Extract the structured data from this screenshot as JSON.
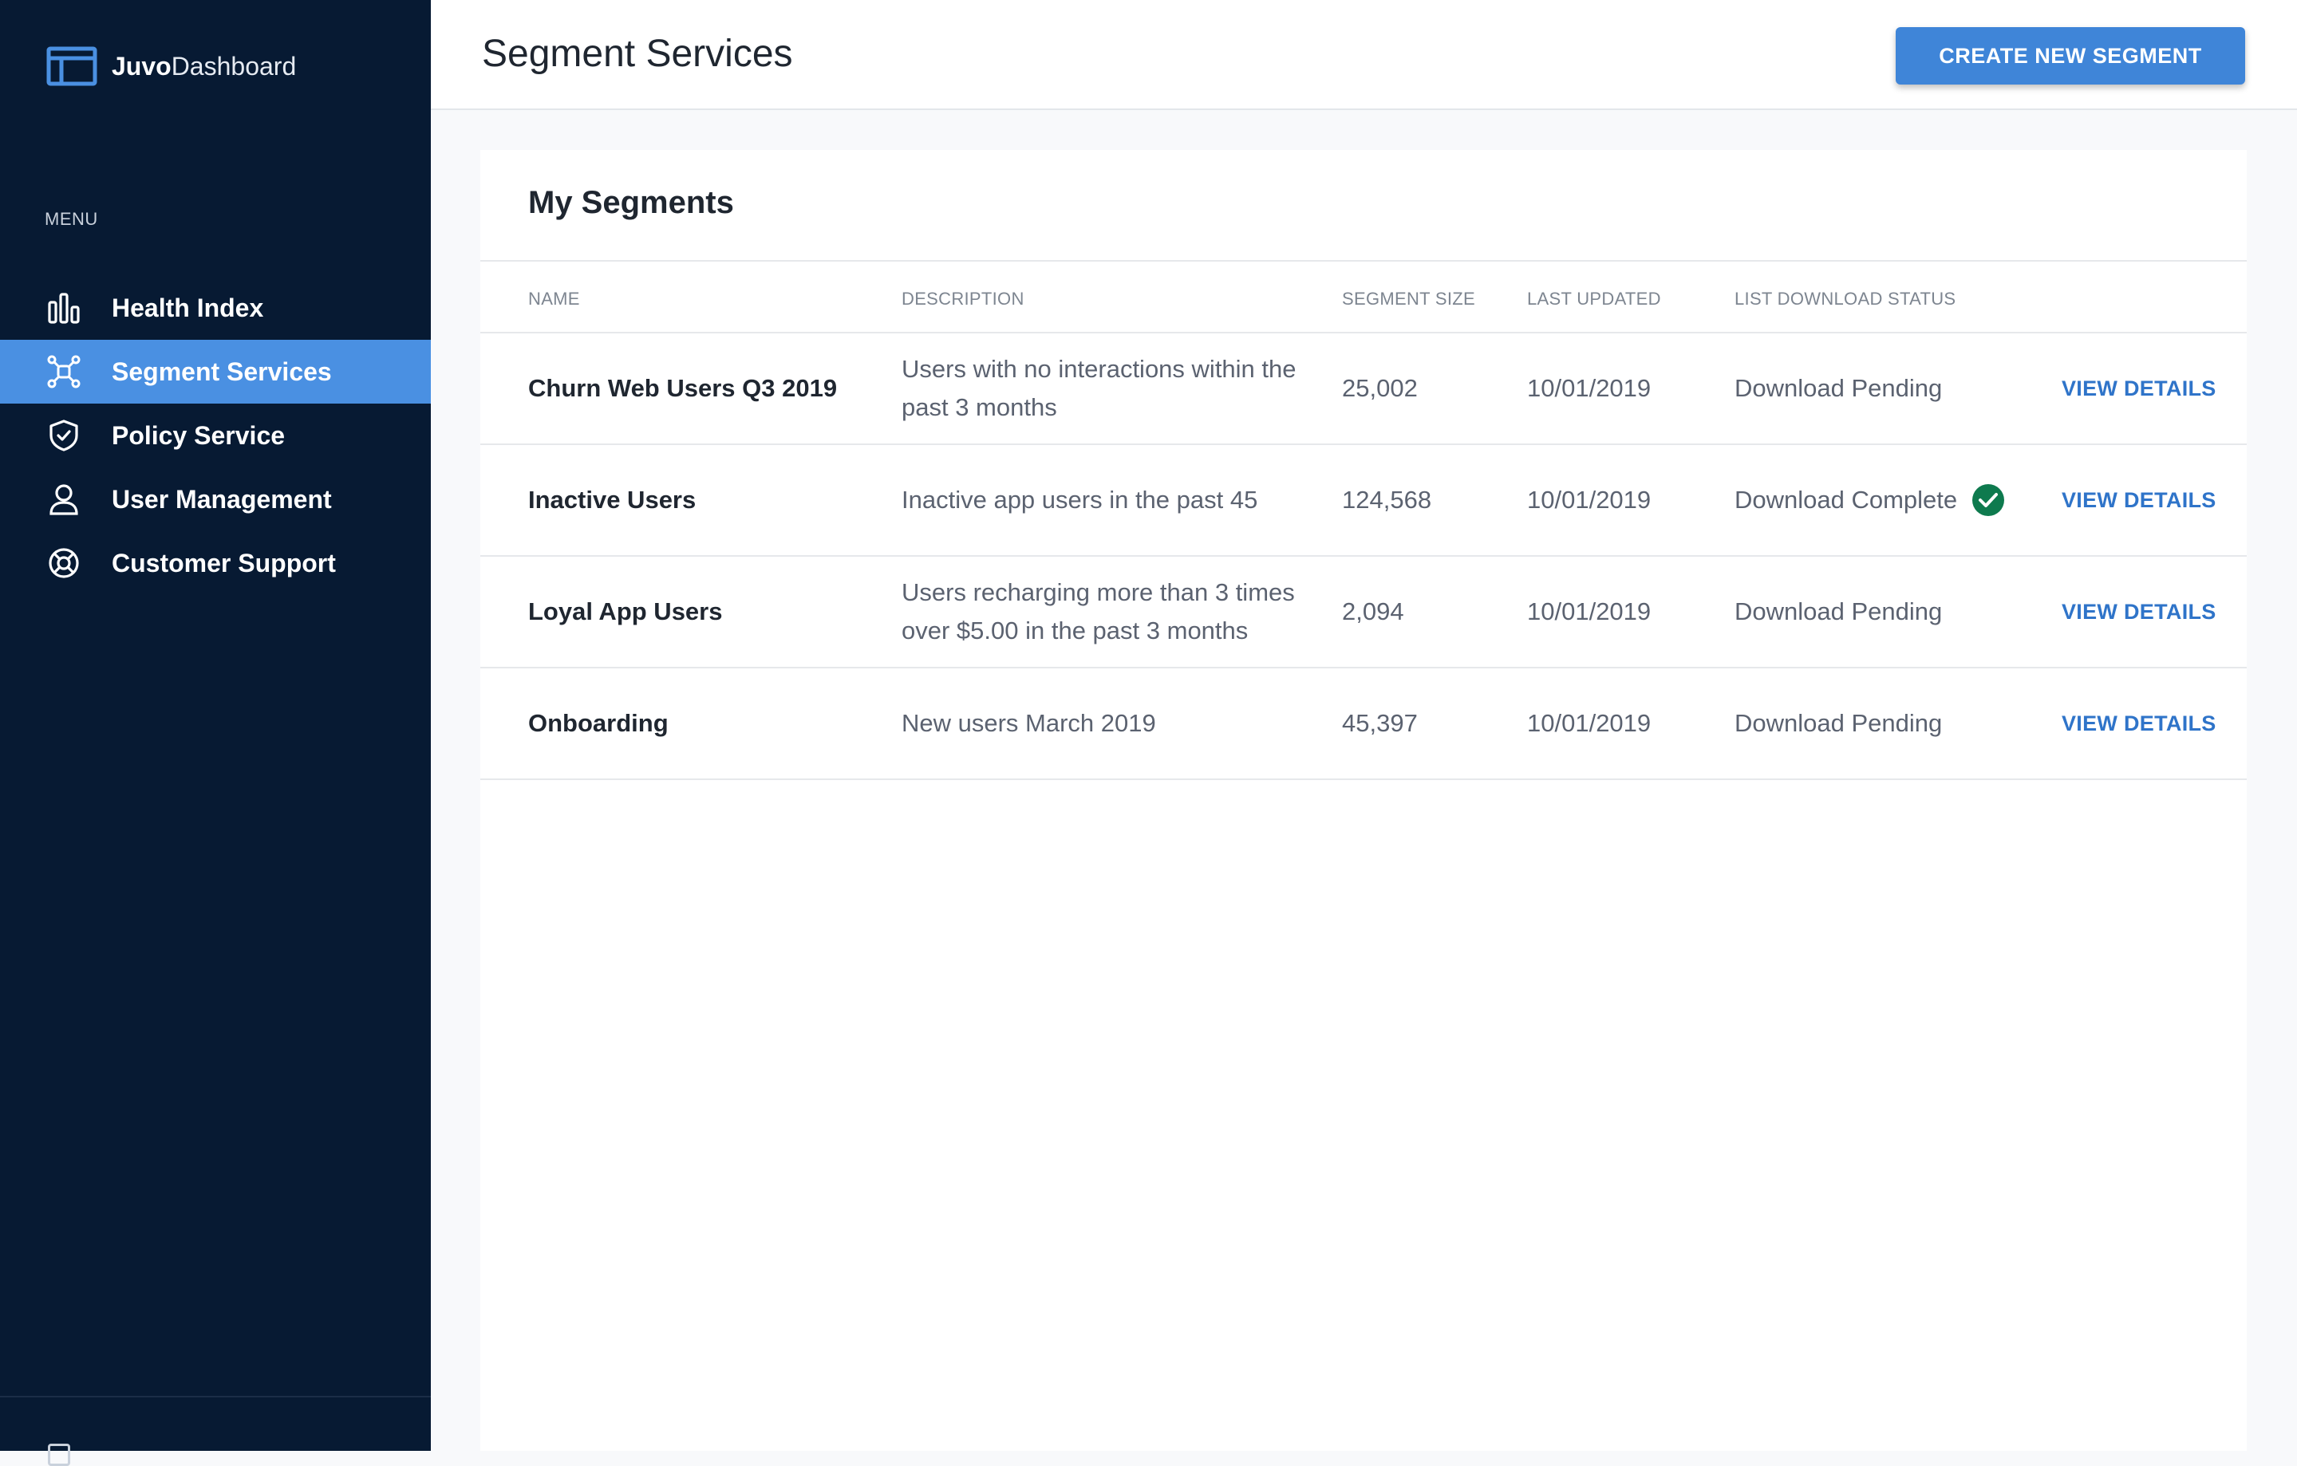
{
  "app": {
    "brand_bold": "Juvo",
    "brand_light": "Dashboard"
  },
  "sidebar": {
    "menu_label": "MENU",
    "items": [
      {
        "label": "Health Index",
        "icon": "bar-chart-icon",
        "active": false
      },
      {
        "label": "Segment Services",
        "icon": "network-icon",
        "active": true
      },
      {
        "label": "Policy Service",
        "icon": "shield-check-icon",
        "active": false
      },
      {
        "label": "User Management",
        "icon": "user-icon",
        "active": false
      },
      {
        "label": "Customer Support",
        "icon": "lifebuoy-icon",
        "active": false
      }
    ]
  },
  "header": {
    "title": "Segment Services",
    "create_button": "CREATE NEW SEGMENT"
  },
  "card": {
    "title": "My Segments",
    "columns": [
      "NAME",
      "DESCRIPTION",
      "SEGMENT SIZE",
      "LAST UPDATED",
      "LIST DOWNLOAD STATUS"
    ],
    "rows": [
      {
        "name": "Churn Web Users Q3 2019",
        "description": "Users with no interactions within the past 3 months",
        "size": "25,002",
        "updated": "10/01/2019",
        "status": "Download Pending",
        "complete": false,
        "action": "VIEW DETAILS"
      },
      {
        "name": "Inactive Users",
        "description": "Inactive app users in the past 45",
        "size": "124,568",
        "updated": "10/01/2019",
        "status": "Download Complete",
        "complete": true,
        "action": "VIEW DETAILS"
      },
      {
        "name": "Loyal App Users",
        "description": "Users recharging more than 3 times over $5.00 in the past 3 months",
        "size": "2,094",
        "updated": "10/01/2019",
        "status": "Download Pending",
        "complete": false,
        "action": "VIEW DETAILS"
      },
      {
        "name": "Onboarding",
        "description": "New users March 2019",
        "size": "45,397",
        "updated": "10/01/2019",
        "status": "Download Pending",
        "complete": false,
        "action": "VIEW DETAILS"
      }
    ]
  },
  "colors": {
    "sidebar_bg": "#071a33",
    "accent": "#4a90e2",
    "button": "#3f85d8",
    "link": "#2f74c9",
    "success": "#0e7a4e"
  }
}
